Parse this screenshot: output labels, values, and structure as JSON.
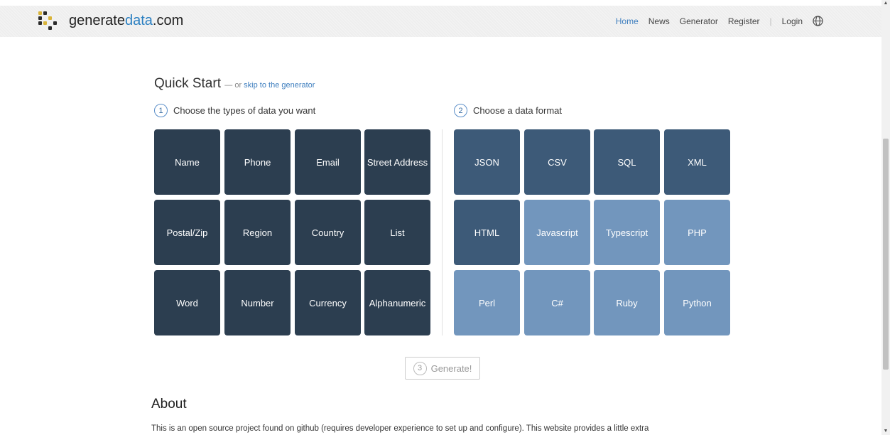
{
  "header": {
    "brand_part1": "generate",
    "brand_part2": "data",
    "brand_part3": ".com",
    "nav": [
      {
        "label": "Home",
        "active": true
      },
      {
        "label": "News"
      },
      {
        "label": "Generator"
      },
      {
        "label": "Register"
      },
      {
        "label": "Login"
      }
    ],
    "separator": "|"
  },
  "quickstart": {
    "title": "Quick Start",
    "or_text": "— or ",
    "skip_link": "skip to the generator",
    "step1": {
      "num": "1",
      "label": "Choose the types of data you want"
    },
    "step2": {
      "num": "2",
      "label": "Choose a data format"
    },
    "data_types": [
      "Name",
      "Phone",
      "Email",
      "Street Address",
      "Postal/Zip",
      "Region",
      "Country",
      "List",
      "Word",
      "Number",
      "Currency",
      "Alphanumeric"
    ],
    "formats": [
      "JSON",
      "CSV",
      "SQL",
      "XML",
      "HTML",
      "Javascript",
      "Typescript",
      "PHP",
      "Perl",
      "C#",
      "Ruby",
      "Python"
    ],
    "generate": {
      "num": "3",
      "label": "Generate!"
    }
  },
  "about": {
    "title": "About",
    "text": "This is an open source project found on github (requires developer experience to set up and configure). This website provides a little extra"
  },
  "colors": {
    "data_tile": "#2c3e50",
    "format_tile_dark": "#3d5a78",
    "format_tile_light": "#7296bd",
    "link": "#3f7fbf"
  }
}
